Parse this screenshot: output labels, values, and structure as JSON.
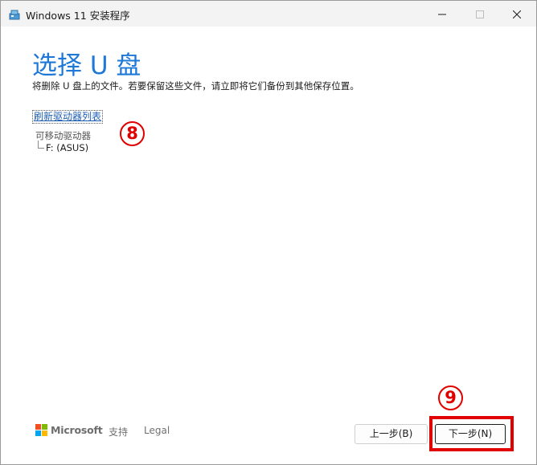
{
  "window": {
    "title": "Windows 11 安装程序"
  },
  "page": {
    "heading": "选择 U 盘",
    "subtitle": "将删除 U 盘上的文件。若要保留这些文件，请立即将它们备份到其他保存位置。",
    "refresh_link": "刷新驱动器列表",
    "drive_tree": {
      "header": "可移动驱动器",
      "items": [
        "F: (ASUS)"
      ]
    }
  },
  "annotations": {
    "marker_8": "8",
    "marker_9": "9",
    "color": "#e00000"
  },
  "footer": {
    "brand": "Microsoft",
    "support": "支持",
    "legal": "Legal"
  },
  "buttons": {
    "back": "上一步(B)",
    "next": "下一步(N)"
  },
  "colors": {
    "accent": "#1e78d7",
    "link": "#1e5fb4",
    "ms_red": "#f25022",
    "ms_green": "#7fba00",
    "ms_blue": "#00a4ef",
    "ms_yellow": "#ffb900"
  },
  "icons": {
    "app": "setup-disk-icon",
    "minimize": "minimize-icon",
    "maximize": "maximize-icon",
    "close": "close-icon"
  }
}
